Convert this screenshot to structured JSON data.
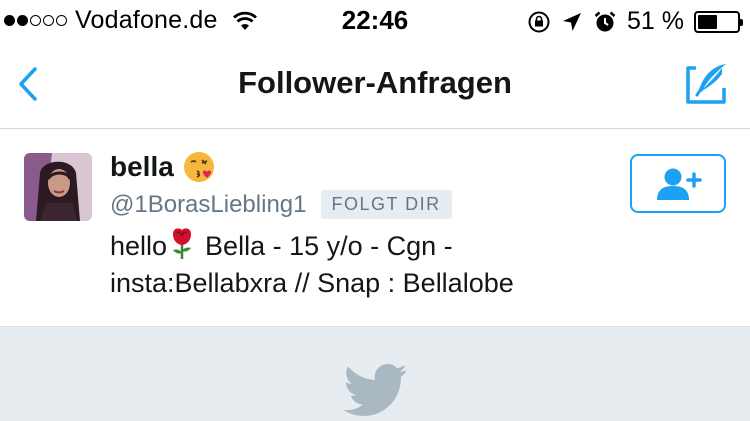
{
  "status_bar": {
    "carrier": "Vodafone.de",
    "time": "22:46",
    "battery_percent": "51 %",
    "battery_level": 0.51,
    "signal_bars_filled": 2,
    "signal_bars_total": 5
  },
  "nav": {
    "title": "Follower-Anfragen",
    "back_icon": "chevron-left-icon",
    "compose_icon": "compose-tweet-icon"
  },
  "request": {
    "name": "bella",
    "name_emoji": "kissing-face-heart-emoji",
    "handle": "@1BorasLiebling1",
    "badge": "FOLGT DIR",
    "bio_prefix": "hello",
    "bio_rest_line1": "Bella - 15 y/o - Cgn -",
    "bio_line2": "insta:Bellabxra // Snap : Bellalobe",
    "follow_icon": "add-user-icon"
  },
  "colors": {
    "accent": "#1da1f2",
    "muted": "#657786",
    "divider": "#d2d6da",
    "footer_bg": "#e6ecf0",
    "bird": "#aab8c2"
  }
}
